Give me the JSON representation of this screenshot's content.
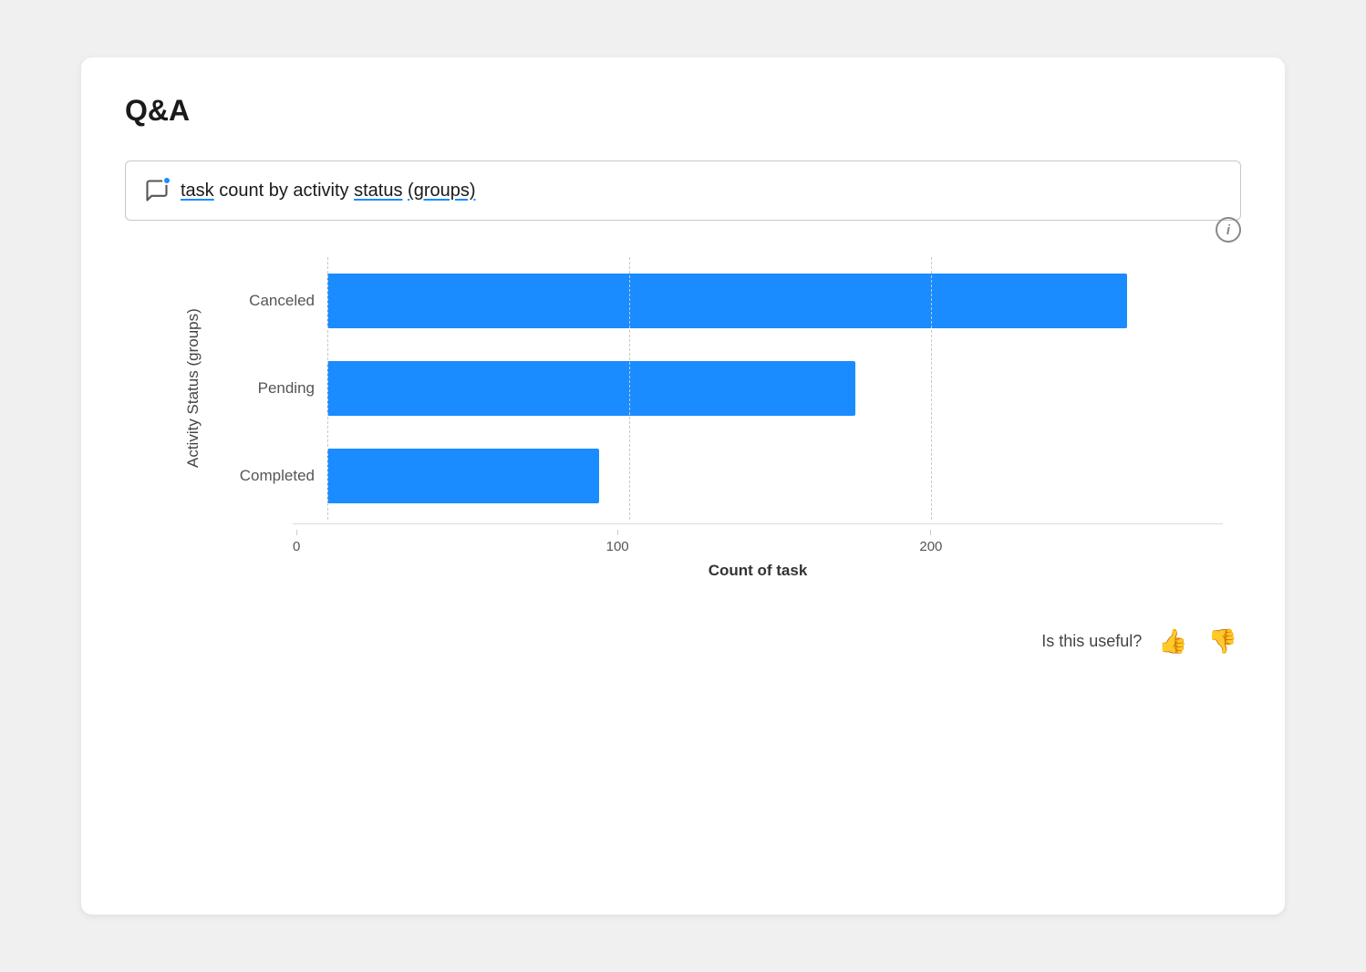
{
  "page": {
    "title": "Q&A"
  },
  "query": {
    "text_plain": "task count by activity status (groups)",
    "text_parts": [
      {
        "text": "task",
        "underline": true
      },
      {
        "text": " count "
      },
      {
        "text": "by",
        "underline": false
      },
      {
        "text": " activity "
      },
      {
        "text": "status",
        "underline": true
      },
      {
        "text": " "
      },
      {
        "text": "(groups)",
        "underline": true
      }
    ]
  },
  "chart": {
    "y_axis_label": "Activity Status (groups)",
    "x_axis_label": "Count of task",
    "x_ticks": [
      "0",
      "100",
      "200"
    ],
    "max_value": 280,
    "bars": [
      {
        "label": "Canceled",
        "value": 265,
        "color": "#1a8cff"
      },
      {
        "label": "Pending",
        "value": 175,
        "color": "#1a8cff"
      },
      {
        "label": "Completed",
        "value": 90,
        "color": "#1a8cff"
      }
    ]
  },
  "feedback": {
    "label": "Is this useful?"
  }
}
